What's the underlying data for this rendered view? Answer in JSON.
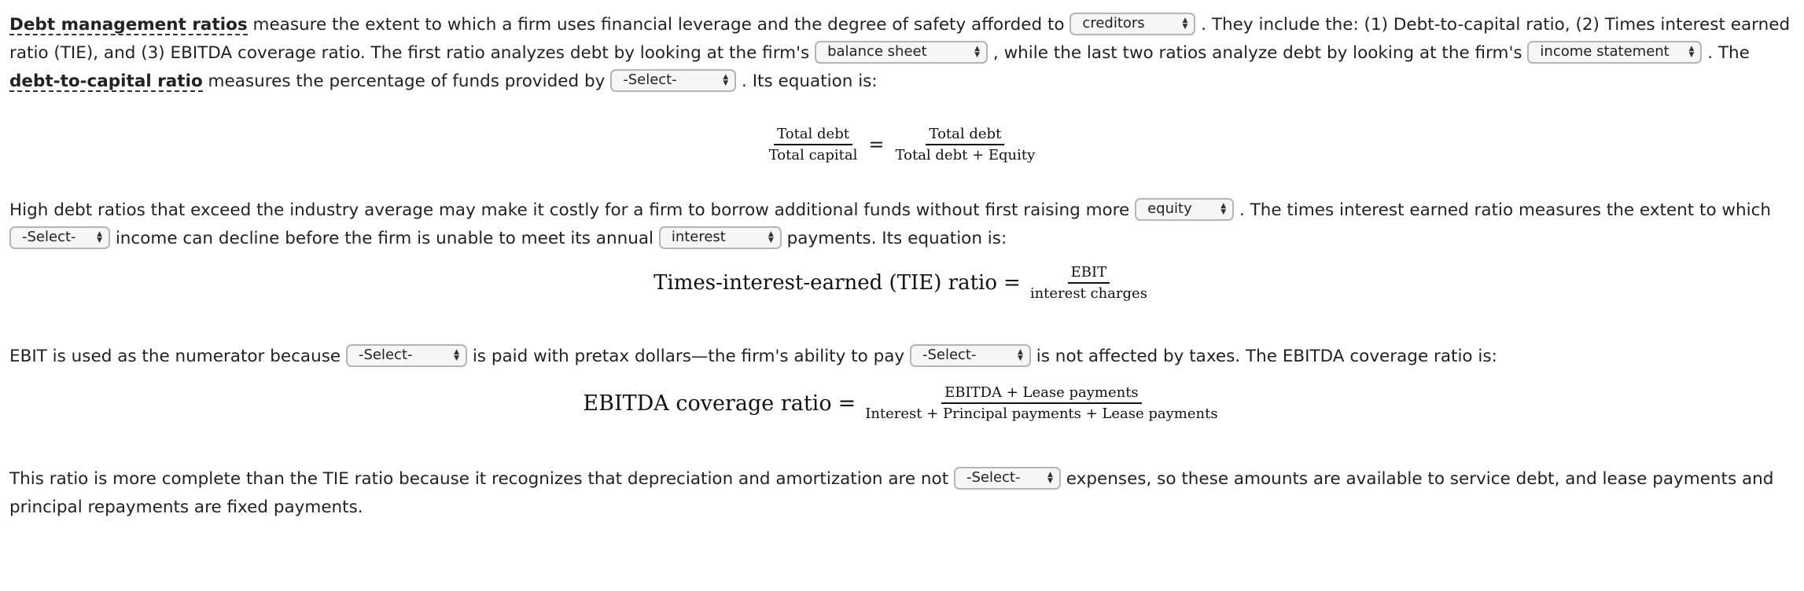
{
  "paragraph1": {
    "term1": "Debt management ratios",
    "t1": " measure the extent to which a firm uses financial leverage and the degree of safety afforded to ",
    "select1": "creditors",
    "t2": " . They include the: (1) Debt-to-capital ratio, (2) Times interest earned ratio (TIE), and (3) EBITDA coverage ratio. The first ratio analyzes debt by looking at the firm's ",
    "select2": "balance sheet",
    "t3": " , while the last two ratios analyze debt by looking at the firm's ",
    "select3": "income statement",
    "t4": " . The ",
    "term2": "debt-to-capital ratio",
    "t5": " measures the percentage of funds provided by ",
    "select4": "-Select-",
    "t6": " . Its equation is:"
  },
  "equation1": {
    "lhs_num": "Total debt",
    "lhs_den": "Total capital",
    "op": "=",
    "rhs_num": "Total debt",
    "rhs_den": "Total debt + Equity"
  },
  "paragraph2": {
    "t1": "High debt ratios that exceed the industry average may make it costly for a firm to borrow additional funds without first raising more ",
    "select1": "equity",
    "t2": " . The times interest earned ratio measures the extent to which ",
    "select2": "-Select-",
    "t3": " income can decline before the firm is unable to meet its annual ",
    "select3": "interest",
    "t4": " payments. Its equation is:"
  },
  "equation2": {
    "lhs": "Times-interest-earned (TIE) ratio",
    "op": "=",
    "num": "EBIT",
    "den": "interest charges"
  },
  "paragraph3": {
    "t1": "EBIT is used as the numerator because ",
    "select1": "-Select-",
    "t2": " is paid with pretax dollars—the firm's ability to pay ",
    "select2": "-Select-",
    "t3": " is not affected by taxes. The EBITDA coverage ratio is:"
  },
  "equation3": {
    "lhs": "EBITDA coverage ratio",
    "op": "=",
    "num": "EBITDA + Lease payments",
    "den": "Interest + Principal payments + Lease payments"
  },
  "paragraph4": {
    "t1": "This ratio is more complete than the TIE ratio because it recognizes that depreciation and amortization are not ",
    "select1": "-Select-",
    "t2": " expenses, so these amounts are available to service debt, and lease payments and principal repayments are fixed payments."
  },
  "icons": {
    "dropdown": "up-down-arrows-icon"
  }
}
